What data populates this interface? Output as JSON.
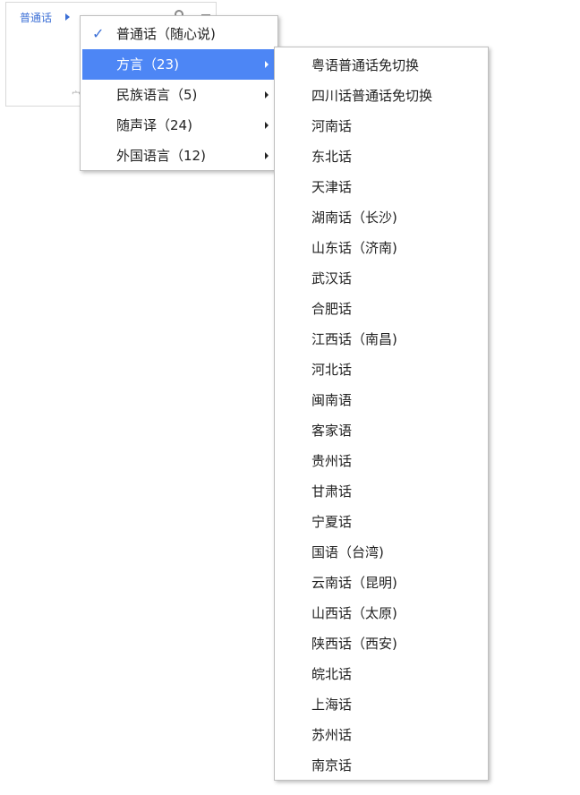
{
  "background": {
    "language_label": "普通话",
    "footer_text": "宀"
  },
  "menu": {
    "items": [
      {
        "label": "普通话（随心说)",
        "checked": true,
        "has_submenu": false
      },
      {
        "label": "方言（23)",
        "checked": false,
        "has_submenu": true,
        "highlighted": true
      },
      {
        "label": "民族语言（5)",
        "checked": false,
        "has_submenu": true
      },
      {
        "label": "随声译（24)",
        "checked": false,
        "has_submenu": true
      },
      {
        "label": "外国语言（12)",
        "checked": false,
        "has_submenu": true
      }
    ],
    "check_glyph": "✓"
  },
  "submenu": {
    "items": [
      "粤语普通话免切换",
      "四川话普通话免切换",
      "河南话",
      "东北话",
      "天津话",
      "湖南话（长沙)",
      "山东话（济南)",
      "武汉话",
      "合肥话",
      "江西话（南昌)",
      "河北话",
      "闽南语",
      "客家语",
      "贵州话",
      "甘肃话",
      "宁夏话",
      "国语（台湾)",
      "云南话（昆明)",
      "山西话（太原)",
      "陕西话（西安)",
      "皖北话",
      "上海话",
      "苏州话",
      "南京话"
    ]
  },
  "colors": {
    "accent": "#3b6fd6",
    "highlight": "#4d86f5"
  }
}
